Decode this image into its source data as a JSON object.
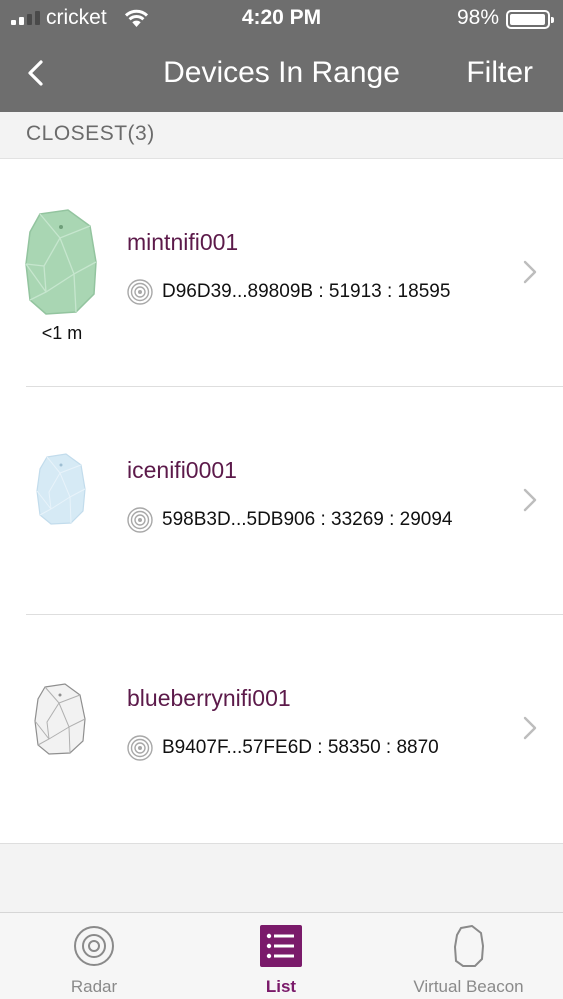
{
  "status_bar": {
    "carrier": "cricket",
    "time": "4:20 PM",
    "battery_pct": "98%",
    "battery_level": 0.98,
    "signal_bars": 2
  },
  "nav": {
    "title": "Devices In Range",
    "filter_label": "Filter",
    "back_icon": "chevron-left-icon"
  },
  "section": {
    "label": "CLOSEST(3)"
  },
  "devices": [
    {
      "name": "mintnifi001",
      "id": "D96D39...89809B : 51913 : 18595",
      "distance": "<1 m",
      "color": "#a9d6b3"
    },
    {
      "name": "icenifi0001",
      "id": "598B3D...5DB906 : 33269 : 29094",
      "distance": "",
      "color": "#d6eaf5"
    },
    {
      "name": "blueberrynifi001",
      "id": "B9407F...57FE6D : 58350 : 8870",
      "distance": "",
      "color": "#f2f2f2"
    }
  ],
  "tabs": [
    {
      "label": "Radar",
      "icon": "radar-icon",
      "active": false
    },
    {
      "label": "List",
      "icon": "list-icon",
      "active": true
    },
    {
      "label": "Virtual Beacon",
      "icon": "beacon-icon",
      "active": false
    }
  ],
  "colors": {
    "accent": "#7a1a6a",
    "device_name": "#5c1a4a",
    "header": "#6e6e6e"
  }
}
